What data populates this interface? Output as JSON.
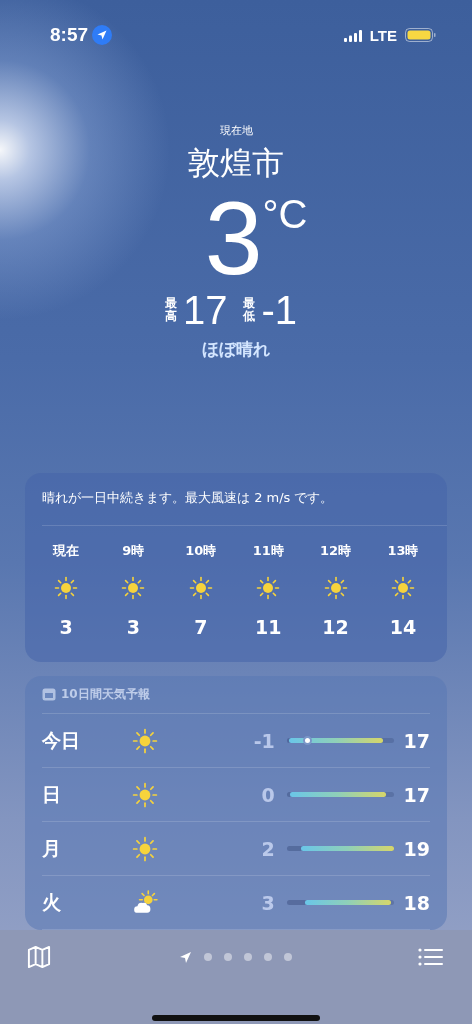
{
  "status_bar": {
    "time": "8:57",
    "network": "LTE"
  },
  "location": {
    "caption": "現在地",
    "city": "敦煌市",
    "temperature": "3",
    "unit": "°C",
    "high_label": "最高",
    "high": "17",
    "low_label": "最低",
    "low": "-1",
    "condition": "ほぼ晴れ"
  },
  "hourly": {
    "summary": "晴れが一日中続きます。最大風速は 2 m/s です。",
    "hours": [
      {
        "label": "現在",
        "kind": "sun",
        "temp": "3"
      },
      {
        "label": "9時",
        "kind": "sun",
        "temp": "3"
      },
      {
        "label": "10時",
        "kind": "sun",
        "temp": "7"
      },
      {
        "label": "11時",
        "kind": "sun",
        "temp": "11"
      },
      {
        "label": "12時",
        "kind": "sun",
        "temp": "12"
      },
      {
        "label": "13時",
        "kind": "sun",
        "temp": "14"
      }
    ]
  },
  "daily": {
    "title": "10日間天気予報",
    "days": [
      {
        "day": "今日",
        "kind": "sun",
        "low": "-1",
        "high": "17",
        "offset": {
          "level": 0.02
        },
        "range": {
          "level": 0.88
        },
        "current": {
          "level": 0.19
        }
      },
      {
        "day": "日",
        "kind": "sun",
        "low": "0",
        "high": "17",
        "offset": {
          "level": 0.03
        },
        "range": {
          "level": 0.89
        }
      },
      {
        "day": "月",
        "kind": "sun",
        "low": "2",
        "high": "19",
        "offset": {
          "level": 0.13
        },
        "range": {
          "level": 0.87
        }
      },
      {
        "day": "火",
        "kind": "partly_cloudy",
        "low": "3",
        "high": "18",
        "offset": {
          "level": 0.17
        },
        "range": {
          "level": 0.8
        }
      }
    ]
  },
  "pages": [
    {
      "kind": "location",
      "selected": true
    },
    {
      "kind": "dot",
      "selected": false
    },
    {
      "kind": "dot",
      "selected": false
    },
    {
      "kind": "dot",
      "selected": false
    },
    {
      "kind": "dot",
      "selected": false
    },
    {
      "kind": "dot",
      "selected": false
    }
  ]
}
